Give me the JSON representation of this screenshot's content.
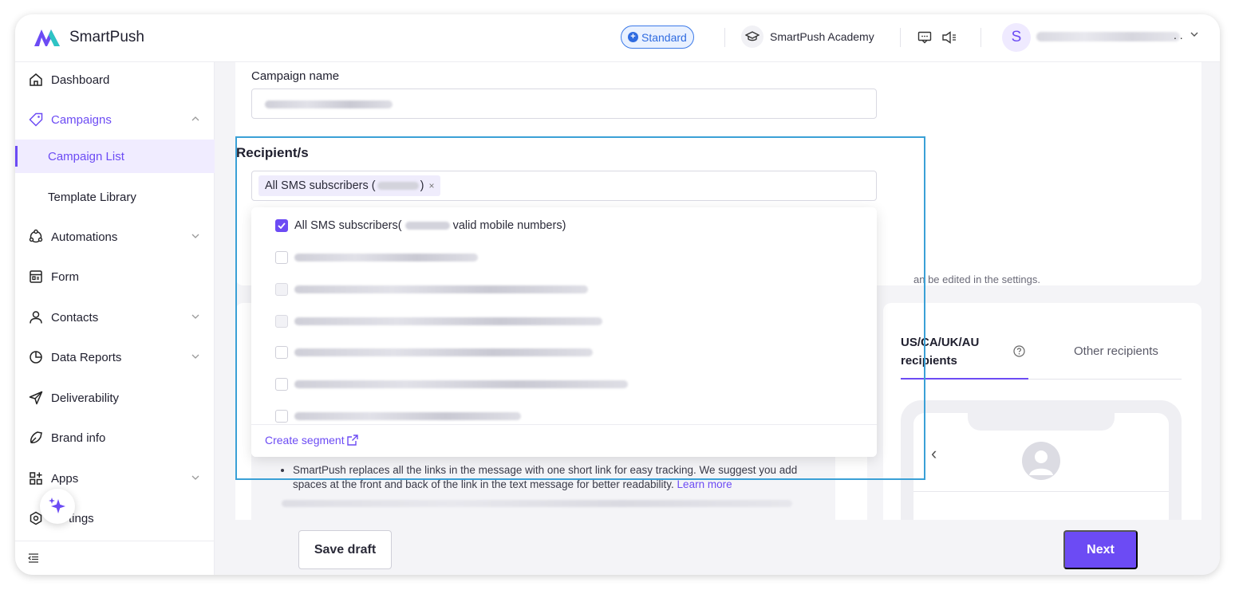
{
  "app": {
    "name": "SmartPush"
  },
  "header": {
    "plan_badge": "Standard",
    "academy_label": "SmartPush Academy",
    "user_initial": "S",
    "user_dots": ". ."
  },
  "sidebar": {
    "items": [
      {
        "label": "Dashboard",
        "icon": "home-icon"
      },
      {
        "label": "Campaigns",
        "icon": "tag-icon"
      },
      {
        "label": "Campaign List"
      },
      {
        "label": "Template Library"
      },
      {
        "label": "Automations",
        "icon": "automation-icon"
      },
      {
        "label": "Form",
        "icon": "form-icon"
      },
      {
        "label": "Contacts",
        "icon": "person-icon"
      },
      {
        "label": "Data Reports",
        "icon": "pie-chart-icon"
      },
      {
        "label": "Deliverability",
        "icon": "send-icon"
      },
      {
        "label": "Brand info",
        "icon": "brand-icon"
      },
      {
        "label": "Apps",
        "icon": "apps-icon"
      },
      {
        "label": "tings",
        "icon": "settings-icon"
      }
    ]
  },
  "form": {
    "campaign_name_label": "Campaign name",
    "recipients_label": "Recipient/s",
    "selected_tag_prefix": "All SMS subscribers (",
    "selected_tag_suffix": ")",
    "tag_remove": "×",
    "options_first_prefix": "All SMS subscribers(",
    "options_first_suffix": "valid mobile numbers)",
    "create_segment": "Create segment",
    "edit_note": "an be edited in the settings."
  },
  "tips": {
    "line1": "SmartPush replaces all the links in the message with one short link for easy tracking. We suggest you add spaces at the front and back of the link in the text message for better readability.",
    "learn_more": "Learn more"
  },
  "preview": {
    "tab_a": "US/CA/UK/AU recipients",
    "tab_b": "Other recipients"
  },
  "footer": {
    "save_draft": "Save draft",
    "next": "Next"
  },
  "colors": {
    "accent": "#6c4bf4",
    "highlight": "#3aa0d6",
    "badge": "#2f6be0"
  }
}
